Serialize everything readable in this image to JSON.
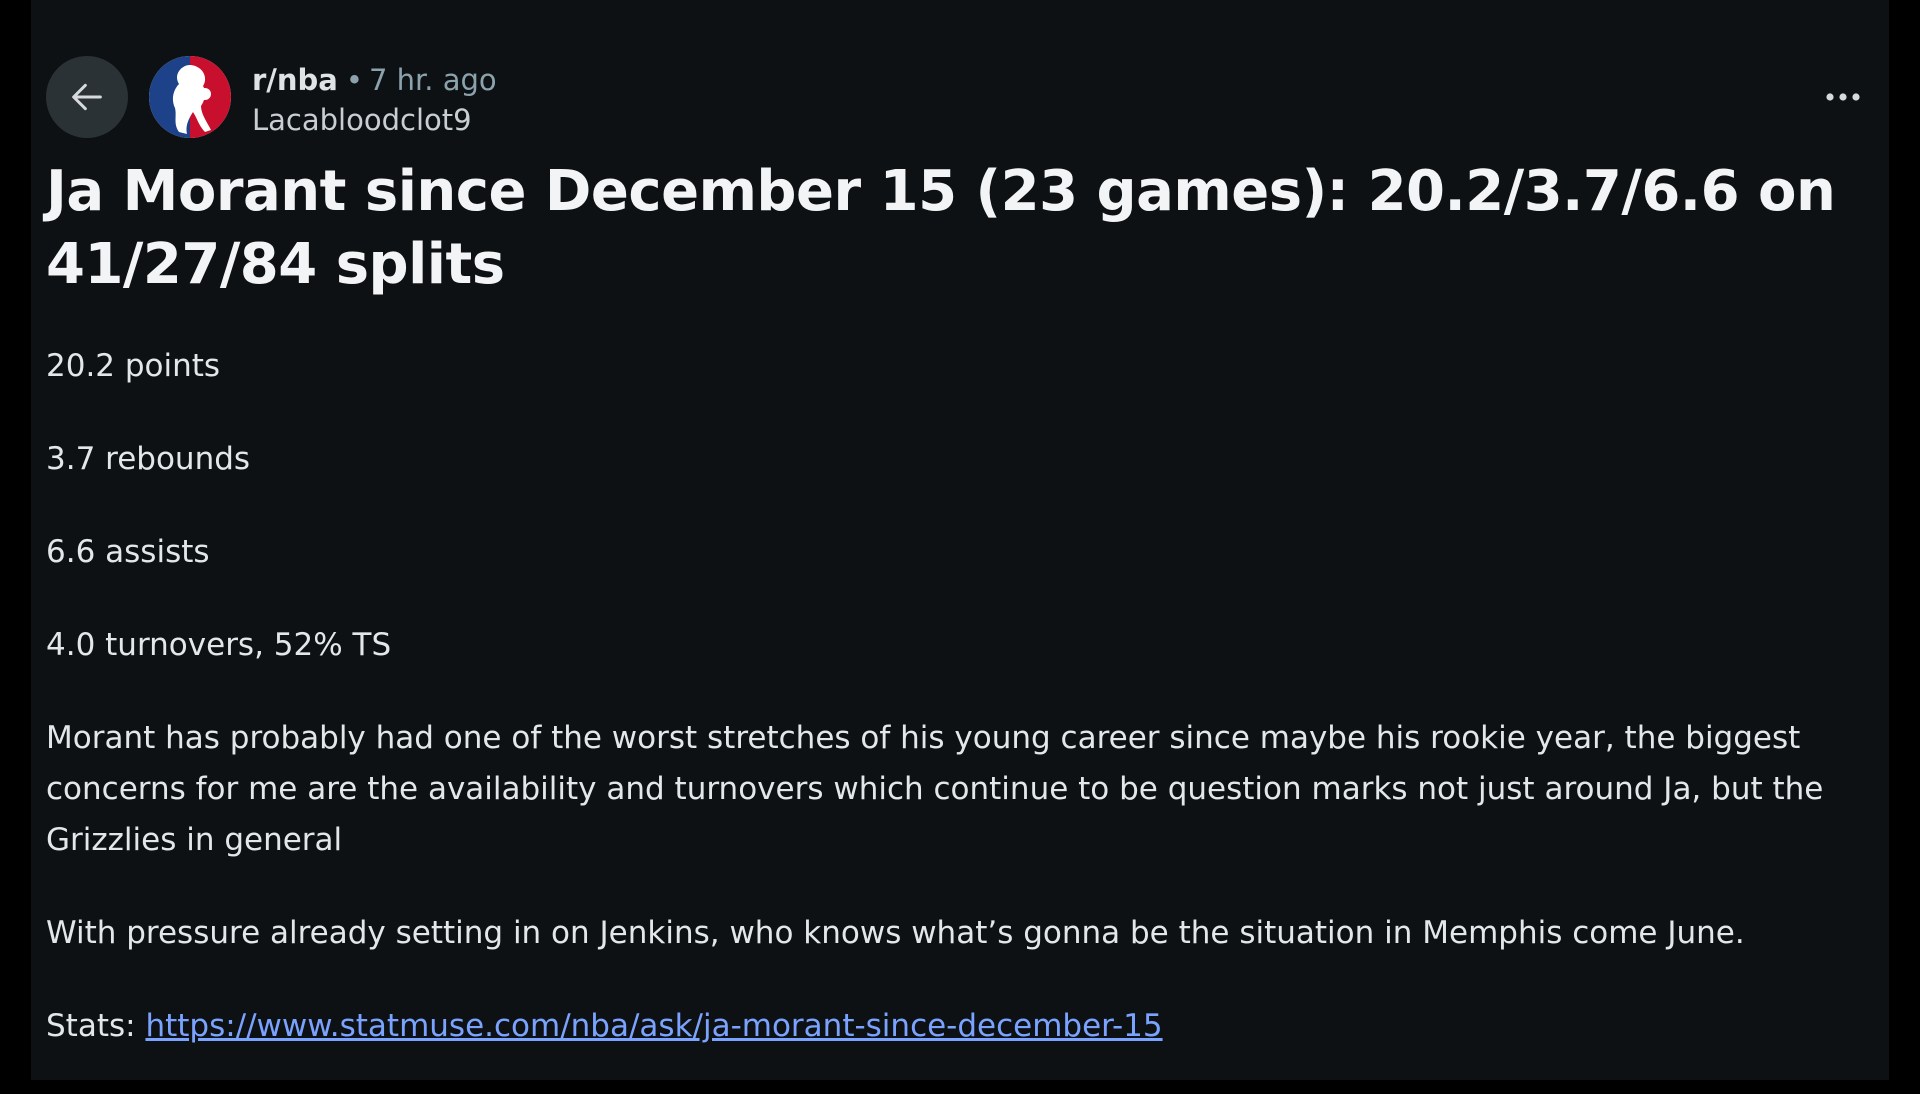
{
  "post": {
    "subreddit": "r/nba",
    "separator": "•",
    "time_ago": "7 hr. ago",
    "author": "Lacabloodclot9",
    "title": "Ja Morant since December 15 (23 games): 20.2/3.7/6.6 on 41/27/84 splits",
    "body": {
      "stat_points": "20.2 points",
      "stat_rebounds": "3.7 rebounds",
      "stat_assists": "6.6 assists",
      "stat_turnovers": "4.0 turnovers, 52% TS",
      "paragraph_1": "Morant has probably had one of the worst stretches of his young career since maybe his rookie year, the biggest concerns for me are the availability and turnovers which continue to be question marks not just around Ja, but the Grizzlies in general",
      "paragraph_2": "With pressure already setting in on Jenkins, who knows what’s gonna be the situation in Memphis come June.",
      "stats_label": "Stats: ",
      "stats_link": "https://www.statmuse.com/nba/ask/ja-morant-since-december-15"
    }
  },
  "icons": {
    "back": "back-arrow-icon",
    "avatar": "nba-logo-icon",
    "more": "more-options-icon"
  },
  "colors": {
    "background": "#0e1113",
    "link": "#7aa2ff",
    "nba_blue": "#1d428a",
    "nba_red": "#c8102e"
  }
}
